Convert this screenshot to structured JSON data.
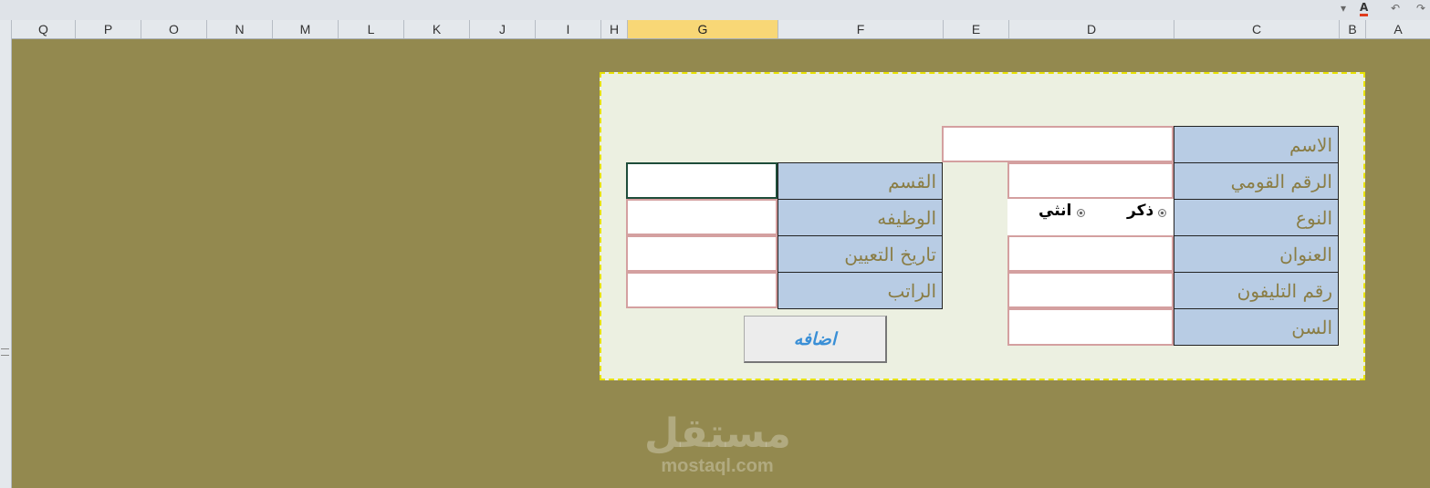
{
  "columns": [
    "Q",
    "P",
    "O",
    "N",
    "M",
    "L",
    "K",
    "J",
    "I",
    "H",
    "G",
    "F",
    "E",
    "D",
    "C",
    "B",
    "A"
  ],
  "selected_column": "G",
  "toolbar": {
    "dropdown_glyph": "▾",
    "font_color_glyph": "A",
    "undo_glyph": "↶",
    "redo_glyph": "↷"
  },
  "form": {
    "labels": {
      "name": "الاسم",
      "national_id": "الرقم القومي",
      "gender": "النوع",
      "address": "العنوان",
      "phone": "رقم التليفون",
      "age": "السن",
      "department": "القسم",
      "job": "الوظيفه",
      "hire_date": "تاريخ التعيين",
      "salary": "الراتب"
    },
    "gender_options": {
      "male": "ذكر",
      "female": "انثي"
    },
    "add_button": "اضافه"
  },
  "watermark": {
    "arabic": "مستقل",
    "latin": "mostaql.com"
  },
  "colors": {
    "sheet_bg": "#93894f",
    "form_bg": "#ecf0e1",
    "label_bg": "#b8cce4",
    "label_text": "#8a7d45",
    "button_text": "#3a8fd6",
    "selected_col": "#f8d776"
  }
}
